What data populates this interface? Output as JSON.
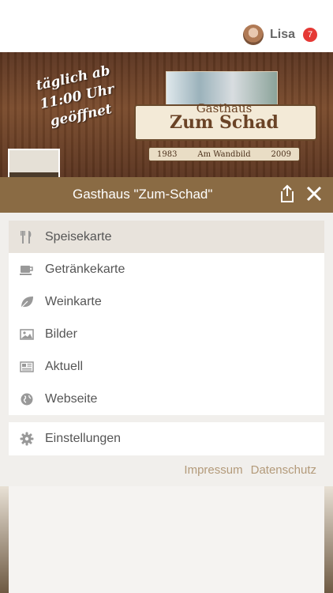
{
  "user": {
    "name": "Lisa",
    "badge": "7"
  },
  "hero": {
    "slogan_line1": "täglich ab",
    "slogan_line2": "11:00 Uhr geöffnet",
    "logo_line1": "Gasthaus",
    "logo_line2": "Zum Schad",
    "logo_year_left": "1983",
    "logo_sub": "Am Wandbild",
    "logo_year_right": "2009"
  },
  "title": "Gasthaus \"Zum-Schad\"",
  "menu": {
    "items": [
      {
        "label": "Speisekarte",
        "icon": "cutlery-icon"
      },
      {
        "label": "Getränkekarte",
        "icon": "cup-icon"
      },
      {
        "label": "Weinkarte",
        "icon": "leaf-icon"
      },
      {
        "label": "Bilder",
        "icon": "image-icon"
      },
      {
        "label": "Aktuell",
        "icon": "newspaper-icon"
      },
      {
        "label": "Webseite",
        "icon": "globe-icon"
      }
    ]
  },
  "settings": {
    "label": "Einstellungen",
    "icon": "gear-icon"
  },
  "footer": {
    "impressum": "Impressum",
    "datenschutz": "Datenschutz"
  },
  "colors": {
    "title_bar": "#8a6b44",
    "active_row": "#e8e3dc",
    "link": "#b39a7a",
    "icon": "#999999",
    "badge": "#e53935"
  }
}
